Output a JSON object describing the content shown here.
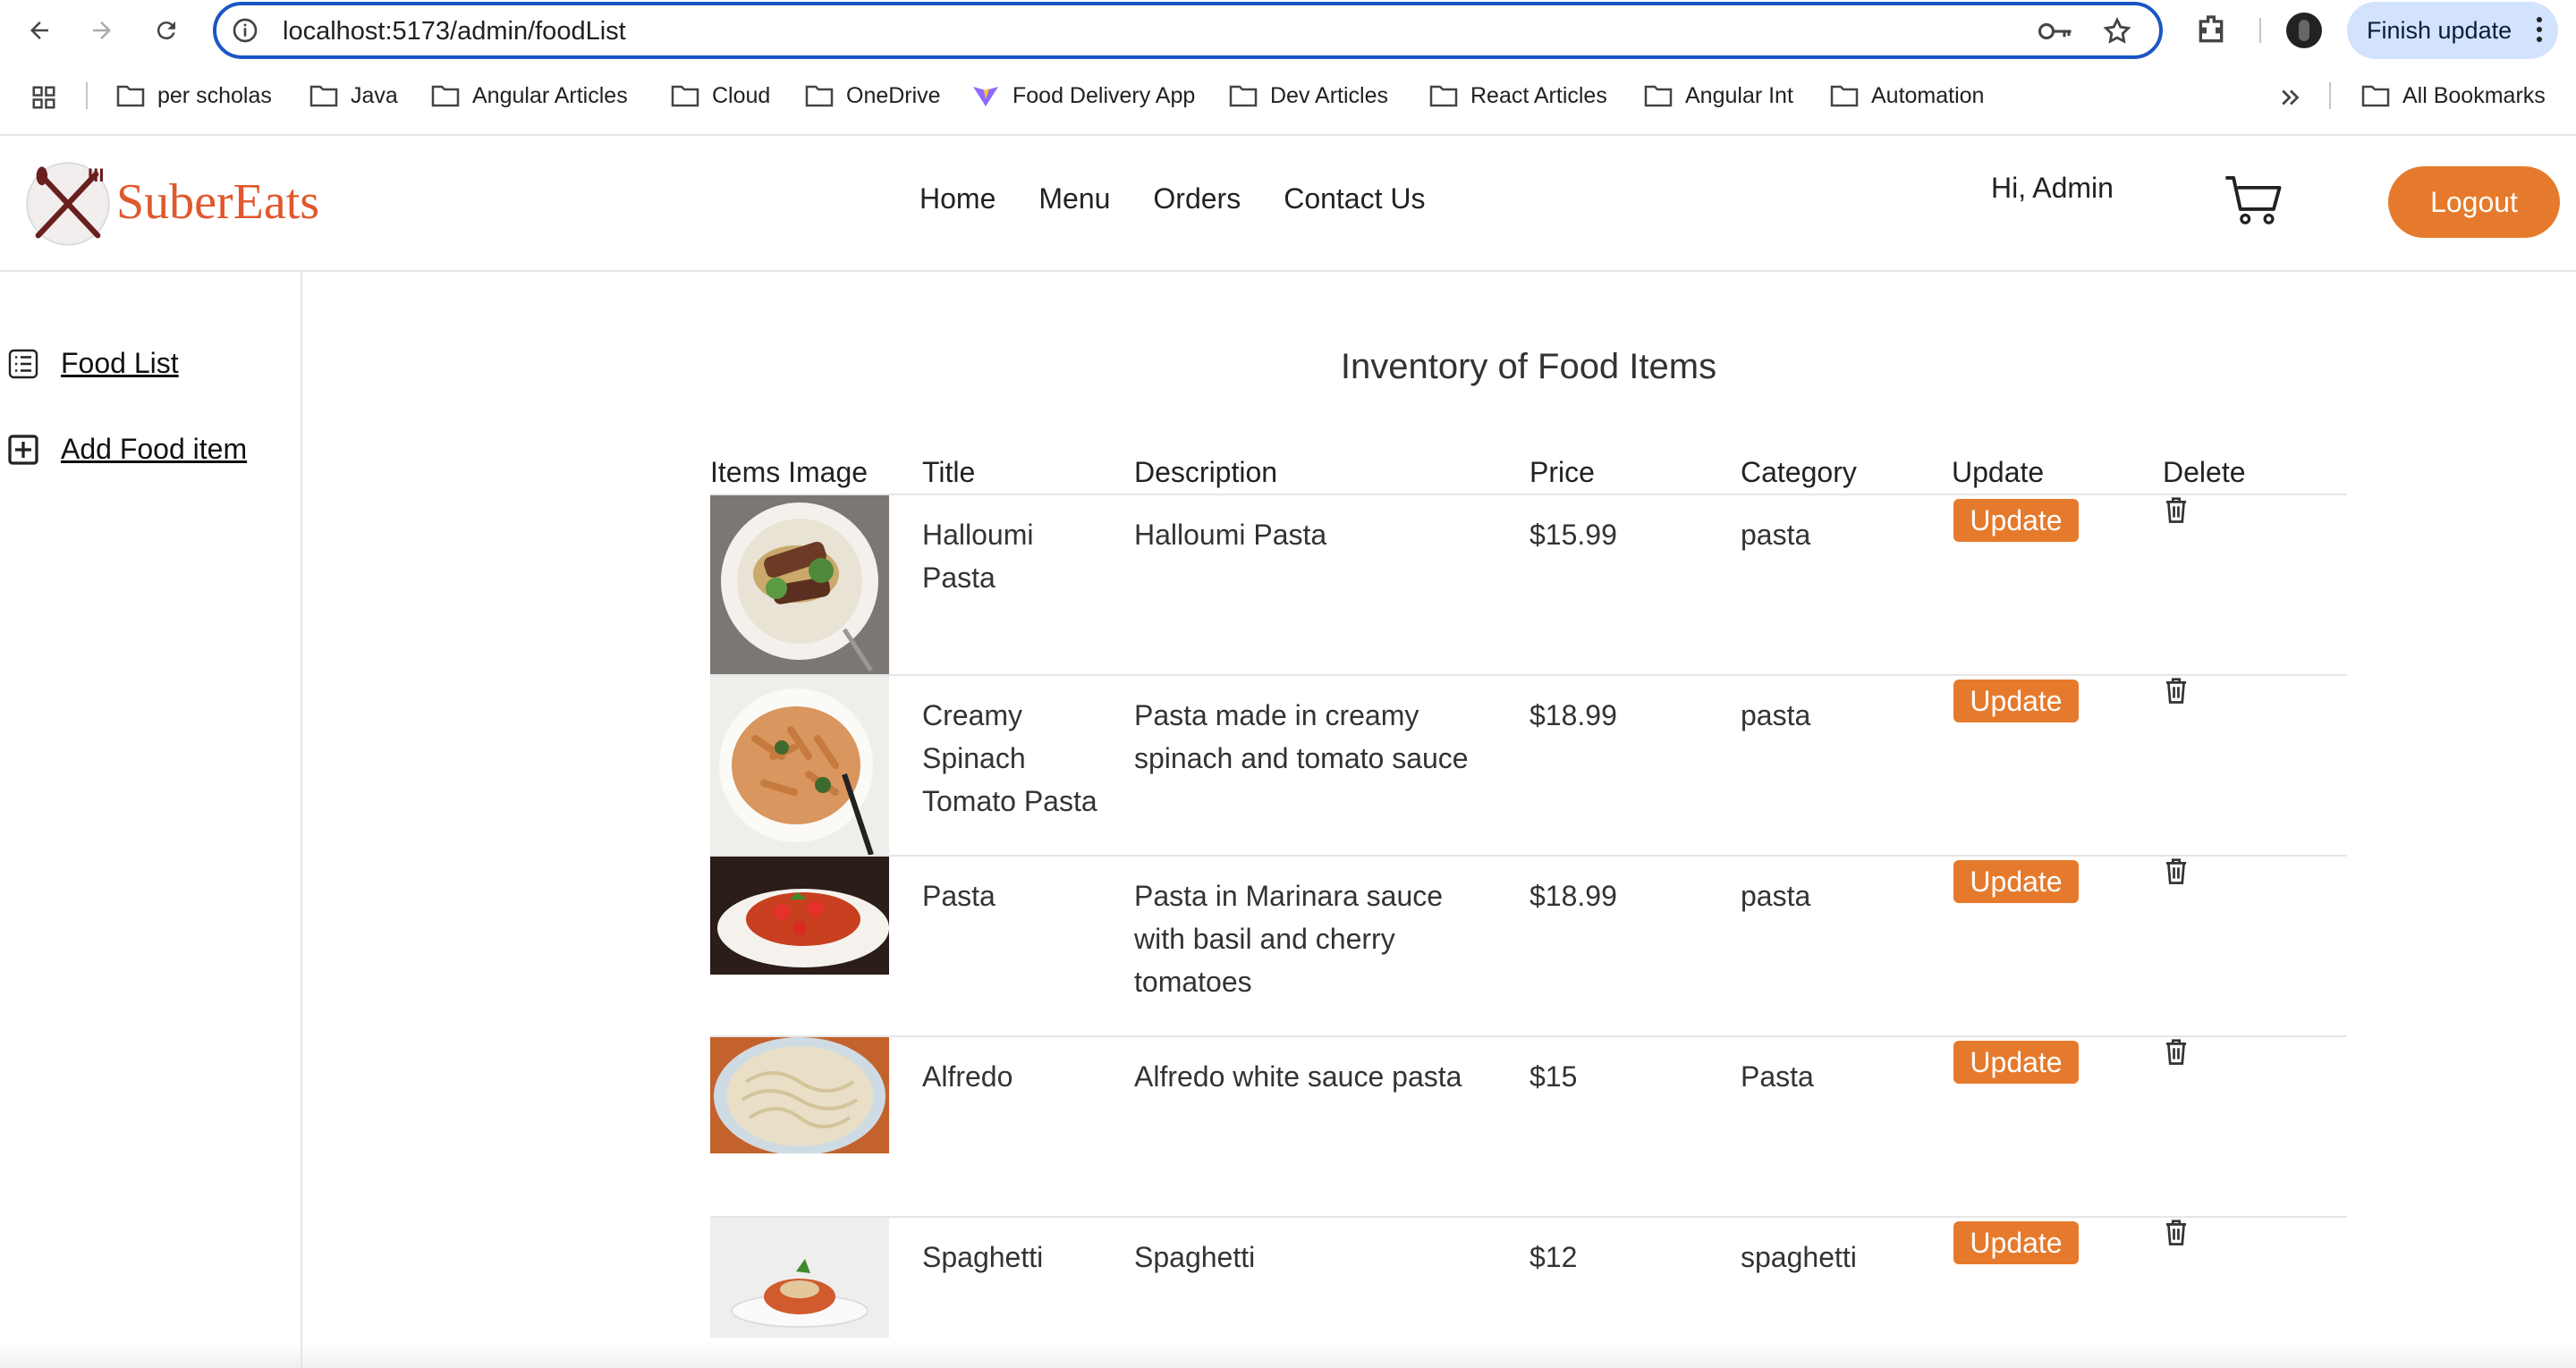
{
  "browser": {
    "url": "localhost:5173/admin/foodList",
    "finish_update_label": "Finish update",
    "bookmarks": [
      "per scholas",
      "Java",
      "Angular Articles",
      "Cloud",
      "OneDrive",
      "Food Delivery App",
      "Dev Articles",
      "React Articles",
      "Angular Int",
      "Automation"
    ],
    "all_bookmarks_label": "All Bookmarks"
  },
  "header": {
    "brand": "SuberEats",
    "nav": [
      "Home",
      "Menu",
      "Orders",
      "Contact Us"
    ],
    "greeting": "Hi, Admin",
    "logout_label": "Logout",
    "accent_color": "#e67a2c"
  },
  "sidebar": {
    "items": [
      {
        "label": "Food List",
        "icon": "list-icon"
      },
      {
        "label": "Add Food item",
        "icon": "plus-square-icon"
      }
    ]
  },
  "main": {
    "title": "Inventory of Food Items",
    "columns": [
      "Items Image",
      "Title",
      "Description",
      "Price",
      "Category",
      "Update",
      "Delete"
    ],
    "update_label": "Update",
    "rows": [
      {
        "title": "Halloumi Pasta",
        "description": "Halloumi Pasta",
        "price": "$15.99",
        "category": "pasta"
      },
      {
        "title": "Creamy Spinach Tomato Pasta",
        "description": "Pasta made in creamy spinach and tomato sauce",
        "price": "$18.99",
        "category": "pasta"
      },
      {
        "title": "Pasta",
        "description": "Pasta in Marinara sauce with basil and cherry tomatoes",
        "price": "$18.99",
        "category": "pasta"
      },
      {
        "title": "Alfredo",
        "description": "Alfredo white sauce pasta",
        "price": "$15",
        "category": "Pasta"
      },
      {
        "title": "Spaghetti",
        "description": "Spaghetti",
        "price": "$12",
        "category": "spaghetti"
      }
    ]
  }
}
